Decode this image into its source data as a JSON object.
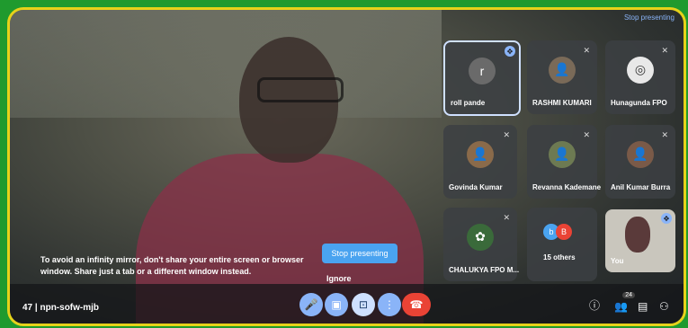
{
  "top_right": {
    "stop_label": "Stop presenting"
  },
  "tiles": [
    {
      "name": "roll pande",
      "avatar": "r"
    },
    {
      "name": "RASHMI KUMARI"
    },
    {
      "name": "Hunagunda FPO"
    },
    {
      "name": "Govinda Kumar"
    },
    {
      "name": "Revanna Kademane"
    },
    {
      "name": "Anil Kumar Burra"
    },
    {
      "name": "CHALUKYA FPO M..."
    },
    {
      "name": "15 others",
      "avatars": [
        "b",
        "B"
      ]
    },
    {
      "name": "You"
    }
  ],
  "dialog": {
    "warning": "To avoid an infinity mirror, don't share your entire screen or browser window. Share just a tab or a different window instead.",
    "stop_button": "Stop presenting",
    "ignore": "Ignore"
  },
  "bottom_bar": {
    "meeting": "47 | npn-sofw-mjb",
    "people_count": "24"
  },
  "colors": {
    "accent": "#8ab4f8",
    "end_call": "#ea4335",
    "frame": "#1f9a2e",
    "border": "#e6d21a"
  }
}
